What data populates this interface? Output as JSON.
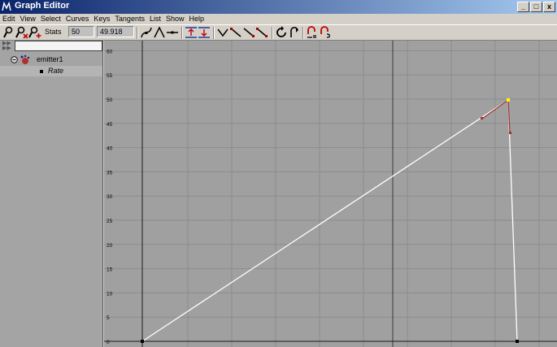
{
  "window": {
    "title": "Graph Editor",
    "buttons": {
      "minimize": "_",
      "maximize": "□",
      "close": "x"
    }
  },
  "menu": [
    "Edit",
    "View",
    "Select",
    "Curves",
    "Keys",
    "Tangents",
    "List",
    "Show",
    "Help"
  ],
  "toolbar": {
    "stats_label": "Stats",
    "frame_value": "50",
    "key_value": "49.918",
    "icons": [
      "move-key-icon",
      "insert-key-icon",
      "add-key-icon",
      "spline-tangent-icon",
      "linear-tangent-icon",
      "flat-tangent-icon",
      "frame-all-icon",
      "frame-playback-icon",
      "clamped-tangent-icon",
      "stepped-tangent-icon",
      "plateau-tangent-icon",
      "fixed-tangent-icon",
      "cycle-icon",
      "break-tangent-icon",
      "buffer-curve-icon",
      "swap-buffer-icon"
    ]
  },
  "outliner": {
    "filter_value": "",
    "items": [
      {
        "label": "emitter1",
        "type": "node"
      },
      {
        "label": "Rate",
        "type": "attribute"
      }
    ]
  },
  "graph": {
    "y_ticks": [
      "0",
      "5",
      "10",
      "15",
      "20",
      "25",
      "30",
      "35",
      "40",
      "45",
      "50",
      "55",
      "60"
    ],
    "colors": {
      "background": "#a0a0a0",
      "grid": "#8c8c8c",
      "axis": "#1a1a1a",
      "curve": "#ffffff",
      "key_selected": "#ffff00",
      "tangent": "#a03030"
    }
  }
}
